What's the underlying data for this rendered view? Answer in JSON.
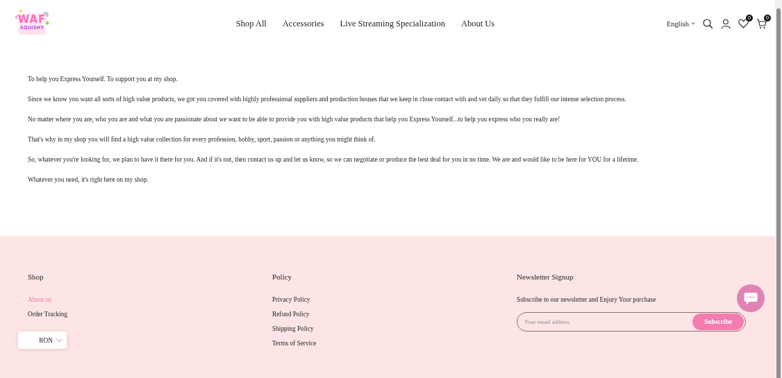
{
  "header": {
    "logo": {
      "line1": "WAF",
      "line2": "SQUISHY"
    },
    "nav": [
      "Shop All",
      "Accessories",
      "Live Streaming Specialization",
      "About Us"
    ],
    "language": "English",
    "wishlist_count": "0",
    "cart_count": "0"
  },
  "content": {
    "paragraphs": [
      "To help you Express Yourself. To support you at my shop.",
      "Since we know you want all sorts of high value products, we got you covered with highly professional suppliers and production houses that we keep in close contact with and vet daily so that they fulfill our intense selection process.",
      "No matter where you are, who you are and what you are passionate about we want to be able to provide you with high value products that help you Express Yourself...to help you express who you really are!",
      "That's why in my shop you will find a high value collection for every profession, hobby, sport, passion or anything you might think of.",
      "So, whatever you're looking for, we plan to have it there for you. And if it's not, then contact us up and let us know, so we can negotiate or produce the best deal for you in no time. We are and would like to be here for YOU for a lifetime.",
      "Whatever you need, it's right here on my shop."
    ]
  },
  "footer": {
    "columns": [
      {
        "title": "Shop",
        "links": [
          {
            "label": "About us",
            "selected": true
          },
          {
            "label": "Order Tracking",
            "selected": false
          }
        ]
      },
      {
        "title": "Policy",
        "links": [
          {
            "label": "Privacy Policy",
            "selected": false
          },
          {
            "label": "Refund Policy",
            "selected": false
          },
          {
            "label": "Shipping Policy",
            "selected": false
          },
          {
            "label": "Terms of Service",
            "selected": false
          }
        ]
      }
    ],
    "newsletter": {
      "title": "Newsletter Signup",
      "text": "Subscribe to our newsletter and Enjury Your purchase",
      "placeholder": "Your email address",
      "button": "Subscribe"
    }
  },
  "currency": "RON"
}
